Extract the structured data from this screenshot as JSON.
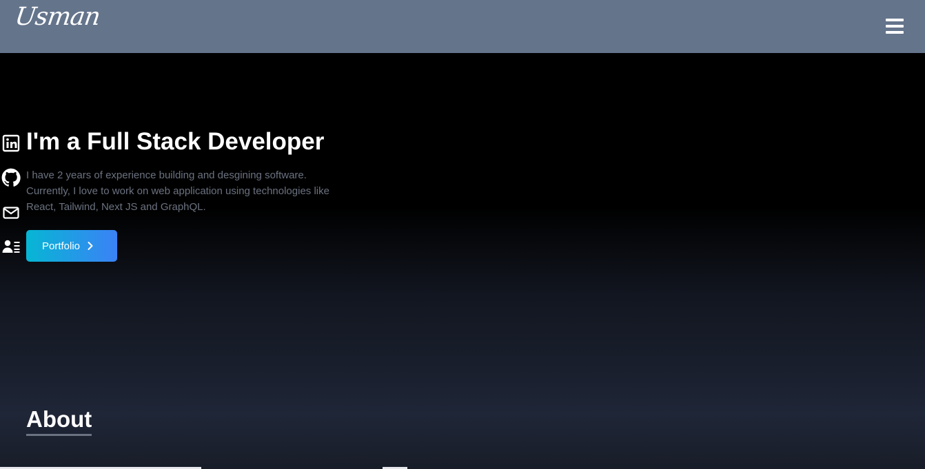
{
  "nav": {
    "logo": "Usman",
    "menu_icon": "hamburger-menu-icon"
  },
  "social": [
    {
      "name": "linkedin",
      "icon": "linkedin-icon"
    },
    {
      "name": "github",
      "icon": "github-icon"
    },
    {
      "name": "email",
      "icon": "mail-icon"
    },
    {
      "name": "resume",
      "icon": "resume-icon"
    }
  ],
  "hero": {
    "title": "I'm a Full Stack Developer",
    "description": "I have 2 years of experience building and desgining software. Currently, I love to work on web application using technologies like React, Tailwind, Next JS and GraphQL.",
    "button_label": "Portfolio",
    "button_icon": "chevron-right-icon"
  },
  "about": {
    "heading": "About"
  },
  "colors": {
    "navbar": "#64748b",
    "accent_from": "#06b6d4",
    "accent_to": "#3b82f6",
    "text_muted": "#6b7280"
  }
}
